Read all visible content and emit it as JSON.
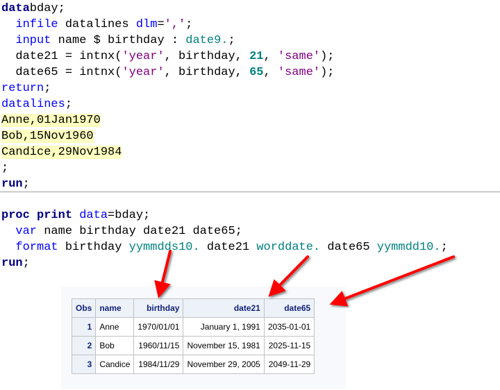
{
  "code_block_1": [
    [
      [
        "kw",
        "data"
      ],
      [
        "",
        "bday;"
      ]
    ],
    [
      [
        "",
        "  "
      ],
      [
        "bl",
        "infile"
      ],
      [
        "",
        " datalines "
      ],
      [
        "bl",
        "dlm"
      ],
      [
        "",
        "="
      ],
      [
        "str",
        "','"
      ],
      [
        "",
        ";"
      ]
    ],
    [
      [
        "",
        "  "
      ],
      [
        "bl",
        "input"
      ],
      [
        "",
        " name $ birthday : "
      ],
      [
        "tl",
        "date9."
      ],
      [
        "",
        ";"
      ]
    ],
    [
      [
        "",
        "  date21 = intnx("
      ],
      [
        "str",
        "'year'"
      ],
      [
        "",
        ", birthday, "
      ],
      [
        "num",
        "21"
      ],
      [
        "",
        ", "
      ],
      [
        "str",
        "'same'"
      ],
      [
        "",
        ");"
      ]
    ],
    [
      [
        "",
        "  date65 = intnx("
      ],
      [
        "str",
        "'year'"
      ],
      [
        "",
        ", birthday, "
      ],
      [
        "num",
        "65"
      ],
      [
        "",
        ", "
      ],
      [
        "str",
        "'same'"
      ],
      [
        "",
        ");"
      ]
    ],
    [
      [
        "bl",
        "return"
      ],
      [
        "",
        ";"
      ]
    ],
    [
      [
        "bl",
        "datalines"
      ],
      [
        "",
        ";"
      ]
    ],
    [
      [
        "dl",
        "Anne,01Jan1970"
      ]
    ],
    [
      [
        "dl",
        "Bob,15Nov1960"
      ]
    ],
    [
      [
        "dl",
        "Candice,29Nov1984"
      ]
    ],
    [
      [
        "",
        ";"
      ]
    ],
    [
      [
        "kw",
        "run"
      ],
      [
        "",
        ";"
      ]
    ]
  ],
  "code_block_2": [
    [
      [
        "kw",
        "proc print"
      ],
      [
        "",
        " "
      ],
      [
        "bl",
        "data"
      ],
      [
        "",
        "=bday;"
      ]
    ],
    [
      [
        "",
        "  "
      ],
      [
        "bl",
        "var"
      ],
      [
        "",
        " name birthday date21 date65;"
      ]
    ],
    [
      [
        "",
        "  "
      ],
      [
        "bl",
        "format"
      ],
      [
        "",
        " birthday "
      ],
      [
        "tl",
        "yymmdds10."
      ],
      [
        "",
        " date21 "
      ],
      [
        "tl",
        "worddate."
      ],
      [
        "",
        " date65 "
      ],
      [
        "tl",
        "yymmdd10."
      ],
      [
        "",
        ";"
      ]
    ],
    [
      [
        "kw",
        "run"
      ],
      [
        "",
        ";"
      ]
    ]
  ],
  "table": {
    "headers": [
      "Obs",
      "name",
      "birthday",
      "date21",
      "date65"
    ],
    "rows": [
      [
        "1",
        "Anne",
        "1970/01/01",
        "January 1, 1991",
        "2035-01-01"
      ],
      [
        "2",
        "Bob",
        "1960/11/15",
        "November 15, 1981",
        "2025-11-15"
      ],
      [
        "3",
        "Candice",
        "1984/11/29",
        "November 29, 2005",
        "2049-11-29"
      ]
    ]
  },
  "colors": {
    "arrow": "#ff0000",
    "keyword": "#000080",
    "highlight": "#ffffc0"
  }
}
